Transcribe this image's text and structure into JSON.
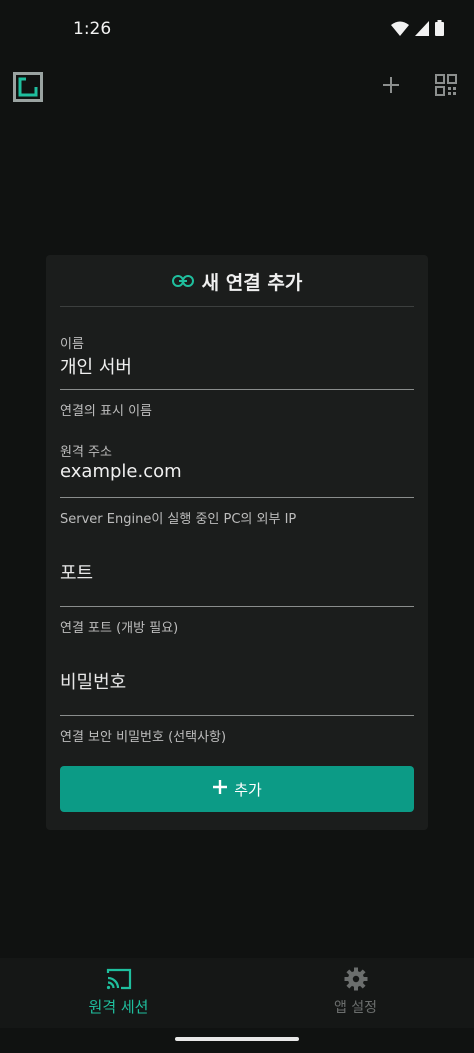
{
  "status_bar": {
    "time": "1:26"
  },
  "colors": {
    "accent": "#0c9b86",
    "accent_text": "#1fbf9e",
    "background": "#101211",
    "card": "#1b1d1c"
  },
  "app_bar": {
    "logo_icon": "app-logo-icon",
    "add_icon": "plus-icon",
    "qr_icon": "qr-code-icon"
  },
  "dialog": {
    "title_icon": "link-icon",
    "title": "새 연결 추가",
    "fields": [
      {
        "label": "이름",
        "value": "개인 서버",
        "helper": "연결의 표시 이름"
      },
      {
        "label": "원격 주소",
        "value": "example.com",
        "helper": "Server Engine이 실행 중인 PC의 외부 IP"
      },
      {
        "placeholder": "포트",
        "helper": "연결 포트 (개방 필요)"
      },
      {
        "placeholder": "비밀번호",
        "helper": "연결 보안 비밀번호 (선택사항)"
      }
    ],
    "add_button": {
      "icon": "plus-icon",
      "label": "추가"
    }
  },
  "bottom_nav": {
    "items": [
      {
        "icon": "cast-icon",
        "label": "원격 세션",
        "active": true
      },
      {
        "icon": "gear-icon",
        "label": "앱 설정",
        "active": false
      }
    ]
  }
}
